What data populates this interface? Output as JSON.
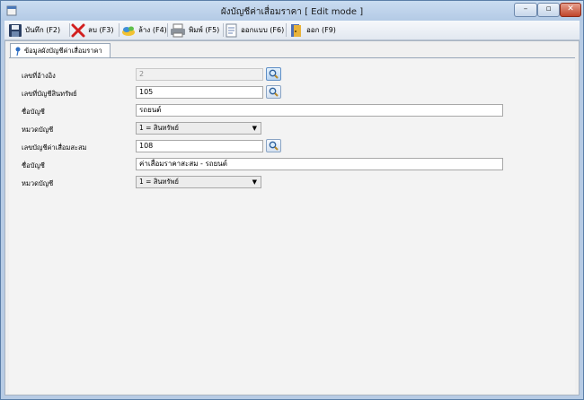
{
  "window": {
    "title": "ผังบัญชีค่าเสื่อมราคา [ Edit mode ]",
    "controls": {
      "minimize": "–",
      "maximize": "▫",
      "close": "✕"
    }
  },
  "toolbar": {
    "items": [
      {
        "id": "save",
        "label": "บันทึก (F2)",
        "icon": "floppy-disk-icon"
      },
      {
        "id": "delete",
        "label": "ลบ (F3)",
        "icon": "red-x-icon"
      },
      {
        "id": "clear",
        "label": "ล้าง (F4)",
        "icon": "eraser-icon"
      },
      {
        "id": "print",
        "label": "พิมพ์ (F5)",
        "icon": "printer-icon"
      },
      {
        "id": "design",
        "label": "ออกแบบ (F6)",
        "icon": "form-design-icon"
      },
      {
        "id": "exit",
        "label": "ออก (F9)",
        "icon": "exit-door-icon"
      }
    ]
  },
  "tab": {
    "label": "ข้อมูลผังบัญชีค่าเสื่อมราคา",
    "icon": "pin-icon"
  },
  "form": {
    "ref_no": {
      "label": "เลขที่อ้างอิง",
      "value": "2"
    },
    "asset_account_no": {
      "label": "เลขที่บัญชีสินทรัพย์",
      "value": "105"
    },
    "asset_account_name": {
      "label": "ชื่อบัญชี",
      "value": "รถยนต์"
    },
    "asset_category": {
      "label": "หมวดบัญชี",
      "value": "1 = สินทรัพย์"
    },
    "accum_dep_account_no": {
      "label": "เลขบัญชีค่าเสื่อมสะสม",
      "value": "108"
    },
    "accum_dep_account_name": {
      "label": "ชื่อบัญชี",
      "value": "ค่าเสื่อมราคาสะสม - รถยนต์"
    },
    "accum_dep_category": {
      "label": "หมวดบัญชี",
      "value": "1 = สินทรัพย์"
    }
  },
  "colors": {
    "title_bar": "#b4cae5",
    "close_button": "#c0452a",
    "panel": "#f3f3f3"
  }
}
